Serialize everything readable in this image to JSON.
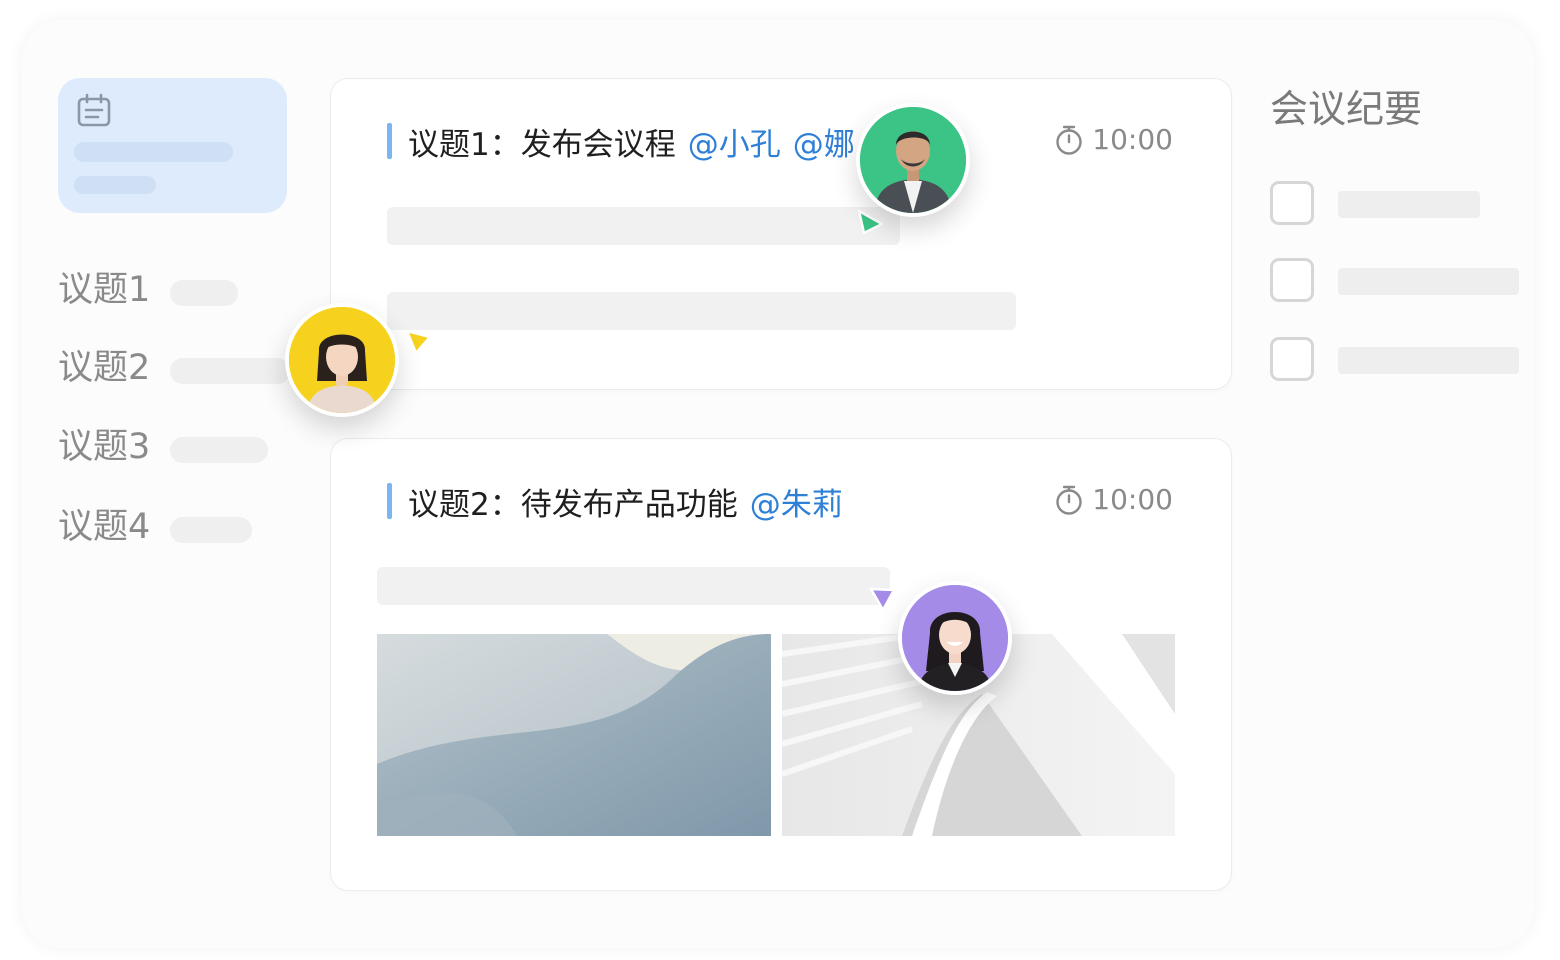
{
  "sidebar": {
    "items": [
      {
        "label": "议题1"
      },
      {
        "label": "议题2"
      },
      {
        "label": "议题3"
      },
      {
        "label": "议题4"
      }
    ]
  },
  "topics": [
    {
      "title": "议题1：发布会议程",
      "mentions": [
        "@小孔",
        "@娜"
      ],
      "time": "10:00"
    },
    {
      "title": "议题2：待发布产品功能",
      "mentions": [
        "@朱莉"
      ],
      "time": "10:00"
    }
  ],
  "summary": {
    "title": "会议纪要"
  },
  "colors": {
    "accent_blue": "#2e7fd6",
    "card_highlight": "#ddebfc",
    "avatar_green": "#3cc486",
    "avatar_yellow": "#f6d21f",
    "avatar_purple": "#a58be8"
  },
  "icons": [
    "calendar-icon",
    "stopwatch-icon",
    "checkbox",
    "cursor-pointer-icon"
  ]
}
